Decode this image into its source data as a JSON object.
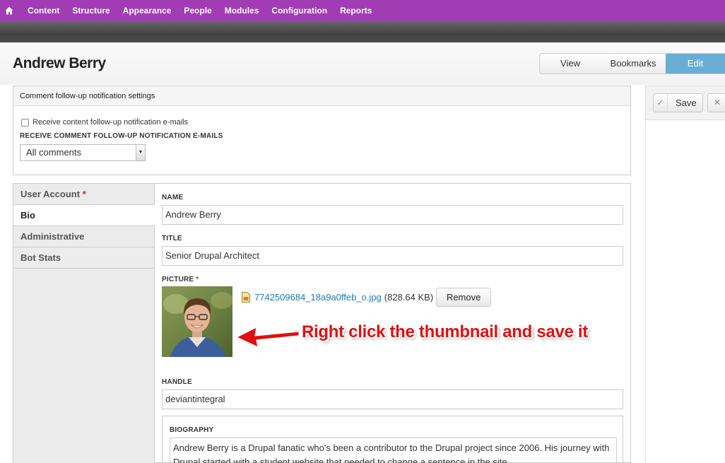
{
  "toolbar": {
    "home_icon": "home-icon",
    "items": [
      "Content",
      "Structure",
      "Appearance",
      "People",
      "Modules",
      "Configuration",
      "Reports"
    ]
  },
  "page": {
    "title": "Andrew Berry",
    "tabs": {
      "view": "View",
      "bookmarks": "Bookmarks",
      "edit": "Edit"
    }
  },
  "notifications": {
    "legend": "Comment follow-up notification settings",
    "checkbox_label": "Receive content follow-up notification e-mails",
    "checkbox_checked": false,
    "select_label": "RECEIVE COMMENT FOLLOW-UP NOTIFICATION E-MAILS",
    "select_value": "All comments"
  },
  "actions": {
    "save": "Save",
    "close_icon": "close-icon"
  },
  "vtabs": {
    "items": [
      {
        "label": "User Account",
        "required": true
      },
      {
        "label": "Bio",
        "required": false
      },
      {
        "label": "Administrative",
        "required": false
      },
      {
        "label": "Bot Stats",
        "required": false
      }
    ],
    "required_marker": "*",
    "active_index": 1
  },
  "bio": {
    "name_label": "NAME",
    "name_value": "Andrew Berry",
    "title_label": "TITLE",
    "title_value": "Senior Drupal Architect",
    "picture_label": "PICTURE",
    "picture_file": "7742509684_18a9a0ffeb_o.jpg",
    "picture_size": "(828.64 KB)",
    "remove_label": "Remove",
    "annotation": "Right click the thumbnail and save it",
    "handle_label": "HANDLE",
    "handle_value": "deviantintegral",
    "biography_label": "BIOGRAPHY",
    "biography_text": "Andrew Berry is a Drupal fanatic who's been a contributor to the Drupal project since 2006. His journey with Drupal started with a student website that needed to change a sentence in the site"
  },
  "colors": {
    "toolbar": "#a13cb4",
    "edit_tab": "#6aaed6",
    "link": "#1f7bb0",
    "annotation": "#e01010",
    "required": "#e0201f"
  }
}
